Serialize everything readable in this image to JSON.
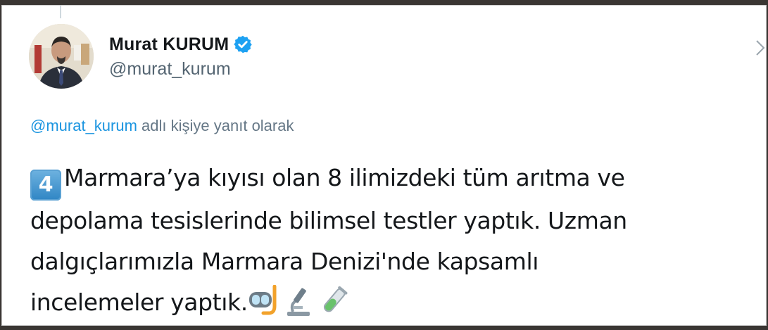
{
  "tweet": {
    "author_name": "Murat KURUM",
    "author_handle": "@murat_kurum",
    "reply_mention": "@murat_kurum",
    "reply_text": " adlı kişiye yanıt olarak",
    "keycap_number": "4",
    "text_line1": "Marmara’ya kıyısı olan 8 ilimizdeki tüm arıtma ve",
    "text_line2": "depolama tesislerinde bilimsel testler yaptık. Uzman",
    "text_line3": "dalgıçlarımızla Marmara Denizi'nde kapsamlı",
    "text_line4": "incelemeler yaptık.",
    "emojis": [
      "diving-mask-icon",
      "microscope-icon",
      "test-tube-icon"
    ]
  },
  "colors": {
    "verified_blue": "#1da1f2",
    "mention_blue": "#1b95e0",
    "secondary_gray": "#657786"
  }
}
